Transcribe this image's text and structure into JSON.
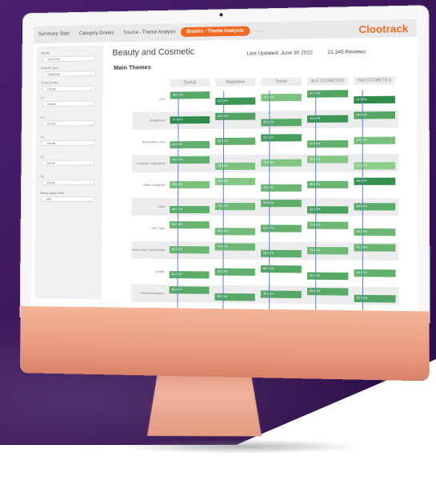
{
  "tabs": [
    {
      "label": "Summary Stats",
      "active": false
    },
    {
      "label": "Category Drivers",
      "active": false
    },
    {
      "label": "Source - Theme Analysis",
      "active": false
    },
    {
      "label": "Brands - Theme Analysis",
      "active": true
    },
    {
      "label": "......",
      "active": false
    }
  ],
  "brand": "Clootrack",
  "filters": [
    {
      "label": "Month",
      "value": "June 2022"
    },
    {
      "label": "Brands Type",
      "value": "Categories"
    },
    {
      "label": "Source Filter",
      "value": "Overall"
    },
    {
      "label": "L2",
      "value": "Overall"
    },
    {
      "label": "L3",
      "value": "Overall"
    },
    {
      "label": "L4",
      "value": "Overall"
    },
    {
      "label": "L5",
      "value": "Overall"
    },
    {
      "label": "L6",
      "value": "Overall"
    },
    {
      "label": "Brand Apply Filter",
      "value": "APB"
    }
  ],
  "page_title": "Beauty and Cosmetic",
  "last_updated": "Last Updated: June 30 2022",
  "reviews": "21,345 Reviews",
  "section_title": "Main Themes",
  "columns": [
    "Overall",
    "Maybelline",
    "Tionali",
    "ALE COSMETICS",
    "PAX COSMETICS"
  ],
  "rows": [
    {
      "label": "Cost",
      "values": [
        "85.57%",
        "93.44%",
        "75.18%",
        "87.73%",
        "97.84%"
      ]
    },
    {
      "label": "Breakthrow",
      "values": [
        "97.94%",
        "88.19%",
        "86.00%",
        "93.12%",
        "86.69%"
      ]
    },
    {
      "label": "Being Well Looks",
      "values": [
        "82.93%",
        "83.07%",
        "91.13%",
        "83.17%",
        "76.67%"
      ]
    },
    {
      "label": "Customer Experience",
      "values": [
        "83.31%",
        "75.53%",
        "73.78%",
        "73.17%",
        "70.93%"
      ]
    },
    {
      "label": "Effect Longevity",
      "values": [
        "76.20%",
        "73.43%",
        "80.03%",
        "80.99%",
        "96.09%"
      ]
    },
    {
      "label": "Price",
      "values": [
        "84.12%",
        "79.12%",
        "83.89%",
        "89.19%",
        "84.99%"
      ]
    },
    {
      "label": "Skin Type",
      "values": [
        "80.75%",
        "78.13%",
        "83.12%",
        "79.92%",
        "80.02%"
      ]
    },
    {
      "label": "Texture And Consistency",
      "values": [
        "80.59%",
        "79.61%",
        "84.07%",
        "79.10%",
        "81.16%"
      ]
    },
    {
      "label": "Quality",
      "values": [
        "84.40%",
        "82.89%",
        "86.74%",
        "86.13%",
        "83.07%"
      ]
    },
    {
      "label": "Recommendation",
      "values": [
        "85.44%",
        "86.13%",
        "86.06%",
        "85.29%",
        "87.59%"
      ]
    }
  ],
  "colors": {
    "accent": "#f26a21",
    "green_dark": "#2e8b4a",
    "green_light": "#8fd08a"
  }
}
